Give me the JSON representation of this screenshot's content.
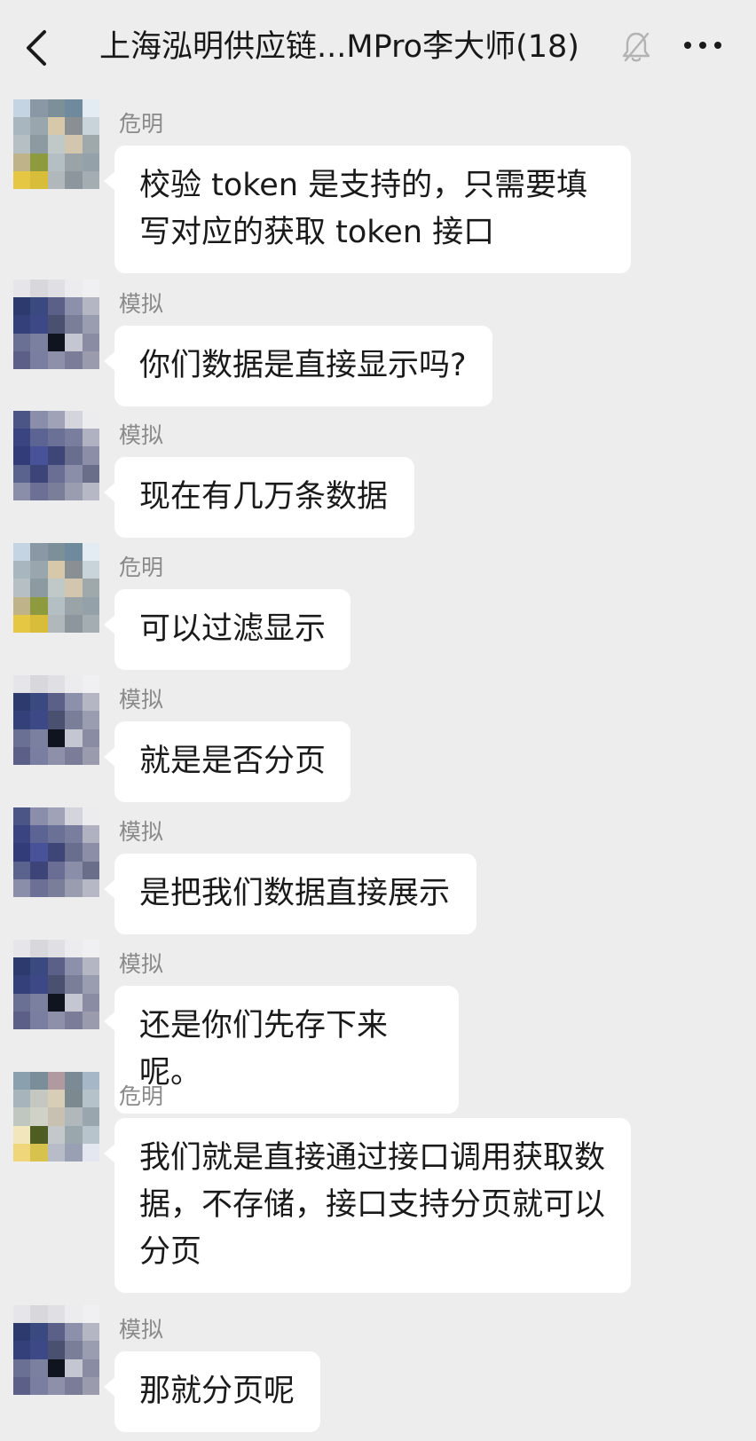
{
  "header": {
    "title": "上海泓明供应链...MPro李大师(18)",
    "back_icon": "chevron-left-icon",
    "mute_icon": "bell-off-icon",
    "more_icon": "more-horizontal-icon"
  },
  "messages": [
    {
      "sender": "危明",
      "text": "校验 token 是支持的，只需要填写对应的获取 token 接口"
    },
    {
      "sender": "模拟",
      "text": "你们数据是直接显示吗?"
    },
    {
      "sender": "模拟",
      "text": "现在有几万条数据"
    },
    {
      "sender": "危明",
      "text": "可以过滤显示"
    },
    {
      "sender": "模拟",
      "text": "就是是否分页"
    },
    {
      "sender": "模拟",
      "text": "是把我们数据直接展示"
    },
    {
      "sender": "模拟",
      "text": "还是你们先存下来呢。"
    },
    {
      "sender": "危明",
      "text": "我们就是直接通过接口调用获取数据，不存储，接口支持分页就可以分页"
    },
    {
      "sender": "模拟",
      "text": "那就分页呢"
    }
  ]
}
